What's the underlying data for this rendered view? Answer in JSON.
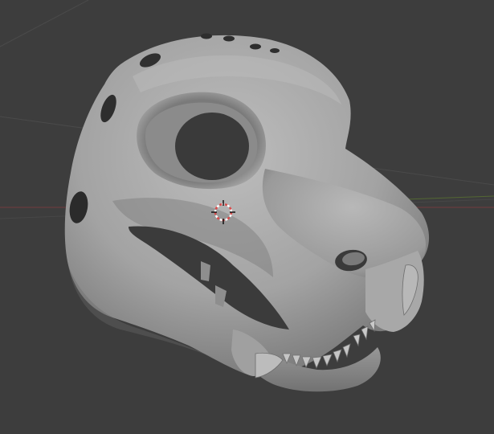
{
  "viewport": {
    "background_color": "#3d3d3d",
    "grid_line_color": "#4a4a4a",
    "x_axis_color": "#8a3a3f",
    "y_axis_color": "#5d7a2f"
  },
  "model": {
    "name": "feline-skull-mask",
    "base_color": "#9c9c9c",
    "shadow_color": "#5f5f5f",
    "highlight_color": "#bdbdbd",
    "hole_color": "#2e2e2e"
  },
  "cursor_3d": {
    "icon": "3d-cursor-icon",
    "ring_color_a": "#d94b4b",
    "ring_color_b": "#ffffff",
    "cross_color": "#111111"
  }
}
